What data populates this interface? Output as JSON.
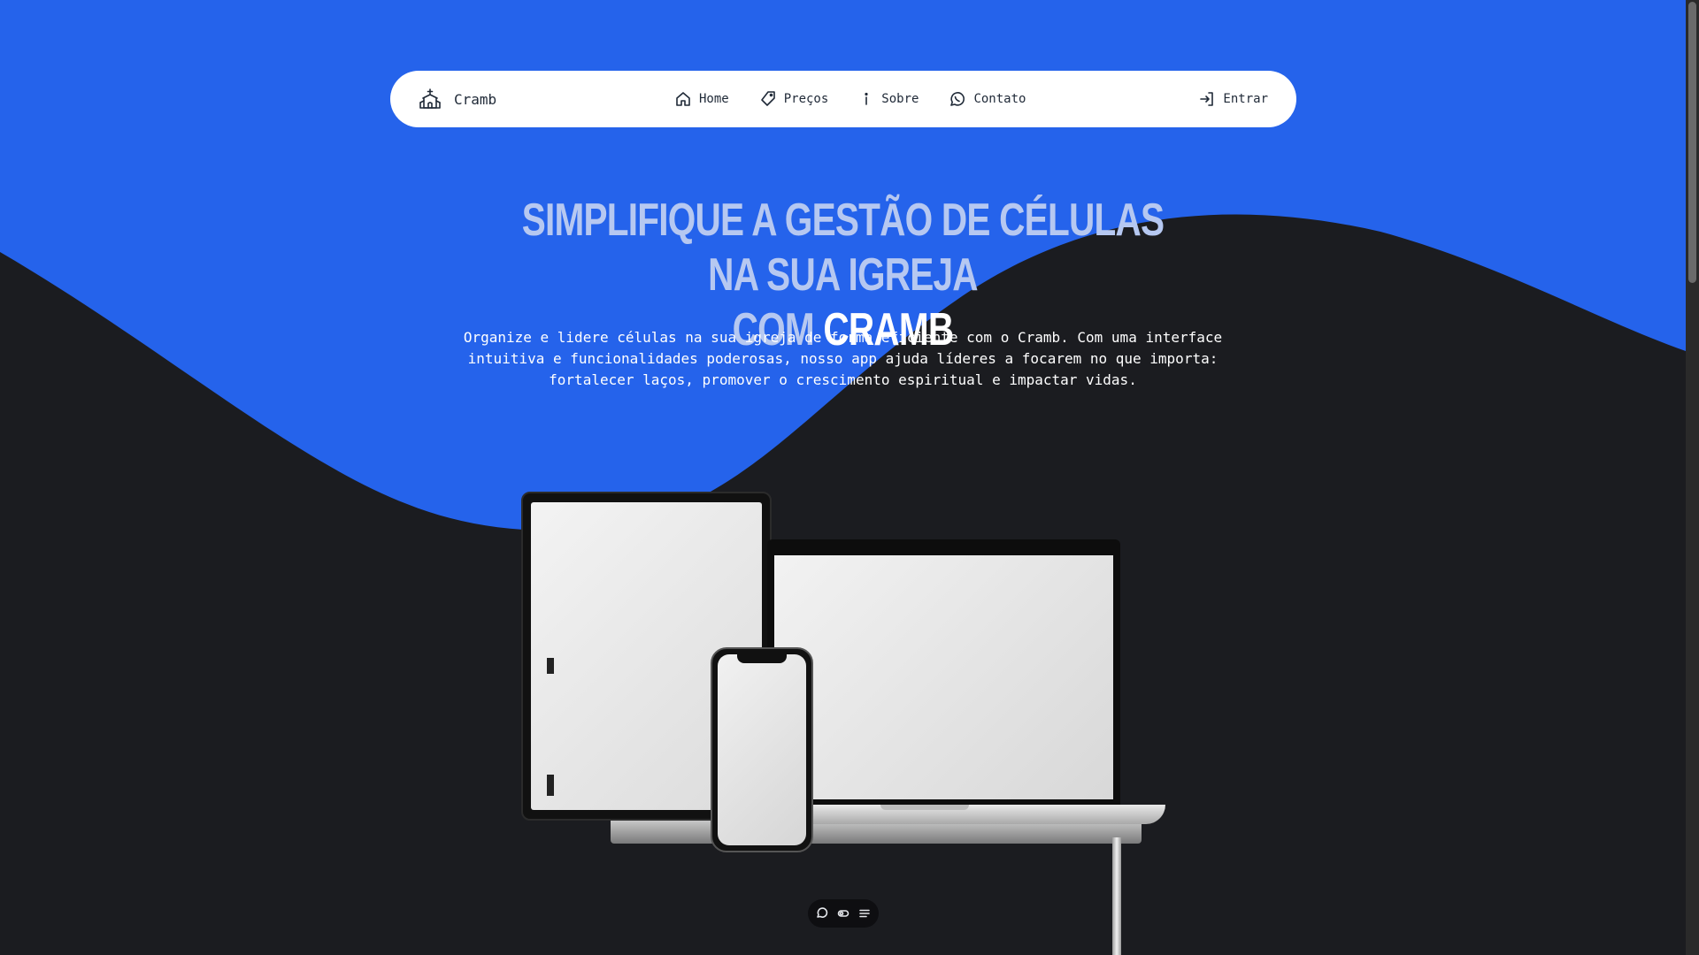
{
  "brand": {
    "name": "Cramb",
    "icon": "church-icon"
  },
  "nav": {
    "links": [
      {
        "label": "Home",
        "icon": "home-icon"
      },
      {
        "label": "Preços",
        "icon": "tag-icon"
      },
      {
        "label": "Sobre",
        "icon": "info-icon"
      },
      {
        "label": "Contato",
        "icon": "whatsapp-icon"
      }
    ],
    "login": {
      "label": "Entrar",
      "icon": "login-icon"
    }
  },
  "hero": {
    "title_line1": "Simplifique a gestão de células na sua igreja",
    "title_prefix": "com",
    "title_brand": "Cramb",
    "description": "Organize e lidere células na sua igreja de forma eficiente com o Cramb. Com uma interface intuitiva e funcionalidades poderosas, nosso app ajuda líderes a focarem no que importa: fortalecer laços, promover o crescimento espiritual e impactar vidas."
  },
  "toolbar": {
    "icons": [
      "chat-icon",
      "toggle-icon",
      "menu-icon"
    ]
  },
  "colors": {
    "primary": "#2563eb",
    "dark": "#1b1c20",
    "title_light": "#b6c8f1"
  }
}
